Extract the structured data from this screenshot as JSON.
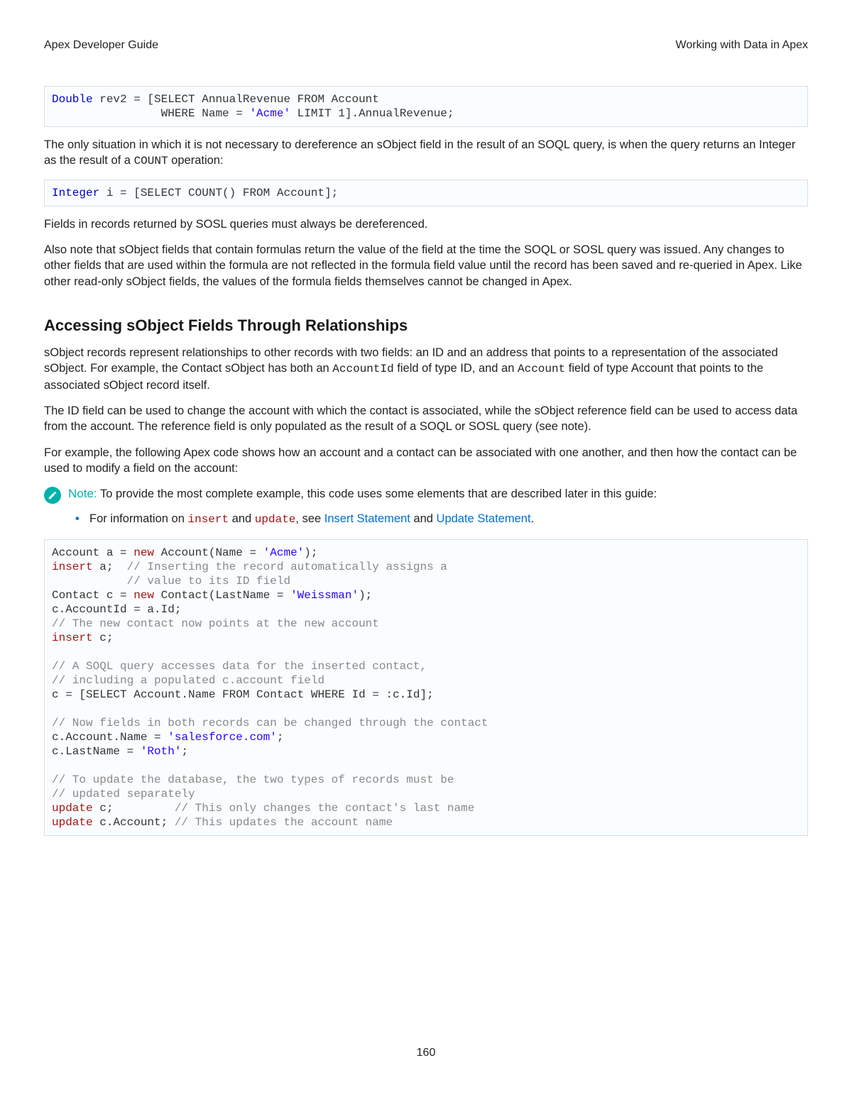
{
  "header": {
    "left": "Apex Developer Guide",
    "right": "Working with Data in Apex"
  },
  "code1": {
    "l1a": "Double",
    "l1b": " rev2 = [SELECT AnnualRevenue FROM Account",
    "l2a": "                WHERE Name = ",
    "l2b": "'Acme'",
    "l2c": " LIMIT 1].AnnualRevenue;"
  },
  "p1a": "The only situation in which it is not necessary to dereference an sObject field in the result of an SOQL query, is when the query returns an Integer as the result of a ",
  "p1code": "COUNT",
  "p1b": " operation:",
  "code2": {
    "a": "Integer",
    "b": " i = [SELECT COUNT() FROM Account];"
  },
  "p2": "Fields in records returned by SOSL queries must always be dereferenced.",
  "p3": "Also note that sObject fields that contain formulas return the value of the field at the time the SOQL or SOSL query was issued. Any changes to other fields that are used within the formula are not reflected in the formula field value until the record has been saved and re-queried in Apex. Like other read-only sObject fields, the values of the formula fields themselves cannot be changed in Apex.",
  "h2": "Accessing sObject Fields Through Relationships",
  "p4a": "sObject records represent relationships to other records with two fields: an ID and an address that points to a representation of the associated sObject. For example, the Contact sObject has both an ",
  "p4code1": "AccountId",
  "p4b": " field of type ID, and an ",
  "p4code2": "Account",
  "p4c": " field of type Account that points to the associated sObject record itself.",
  "p5": "The ID field can be used to change the account with which the contact is associated, while the sObject reference field can be used to access data from the account. The reference field is only populated as the result of a SOQL or SOSL query (see note).",
  "p6": "For example, the following Apex code shows how an account and a contact can be associated with one another, and then how the contact can be used to modify a field on the account:",
  "note": {
    "label": "Note:",
    "text": "To provide the most complete example, this code uses some elements that are described later in this guide:"
  },
  "bullet": {
    "a": "For information on ",
    "code1": "insert",
    "b": " and ",
    "code2": "update",
    "c": ", see ",
    "link1": "Insert Statement",
    "d": " and ",
    "link2": "Update Statement",
    "e": "."
  },
  "code3": {
    "l1a": "Account a = ",
    "l1b": "new",
    "l1c": " Account(Name = ",
    "l1d": "'Acme'",
    "l1e": ");",
    "l2a": "insert",
    "l2b": " a;  ",
    "l2c": "// Inserting the record automatically assigns a",
    "l3": "           // value to its ID field",
    "l4a": "Contact c = ",
    "l4b": "new",
    "l4c": " Contact(LastName = ",
    "l4d": "'Weissman'",
    "l4e": ");",
    "l5": "c.AccountId = a.Id;",
    "l6": "// The new contact now points at the new account",
    "l7a": "insert",
    "l7b": " c;",
    "l8": "",
    "l9": "// A SOQL query accesses data for the inserted contact,",
    "l10": "// including a populated c.account field",
    "l11": "c = [SELECT Account.Name FROM Contact WHERE Id = :c.Id];",
    "l12": "",
    "l13": "// Now fields in both records can be changed through the contact",
    "l14a": "c.Account.Name = ",
    "l14b": "'salesforce.com'",
    "l14c": ";",
    "l15a": "c.LastName = ",
    "l15b": "'Roth'",
    "l15c": ";",
    "l16": "",
    "l17": "// To update the database, the two types of records must be",
    "l18": "// updated separately",
    "l19a": "update",
    "l19b": " c;         ",
    "l19c": "// This only changes the contact's last name",
    "l20a": "update",
    "l20b": " c.Account; ",
    "l20c": "// This updates the account name"
  },
  "pageNumber": "160"
}
